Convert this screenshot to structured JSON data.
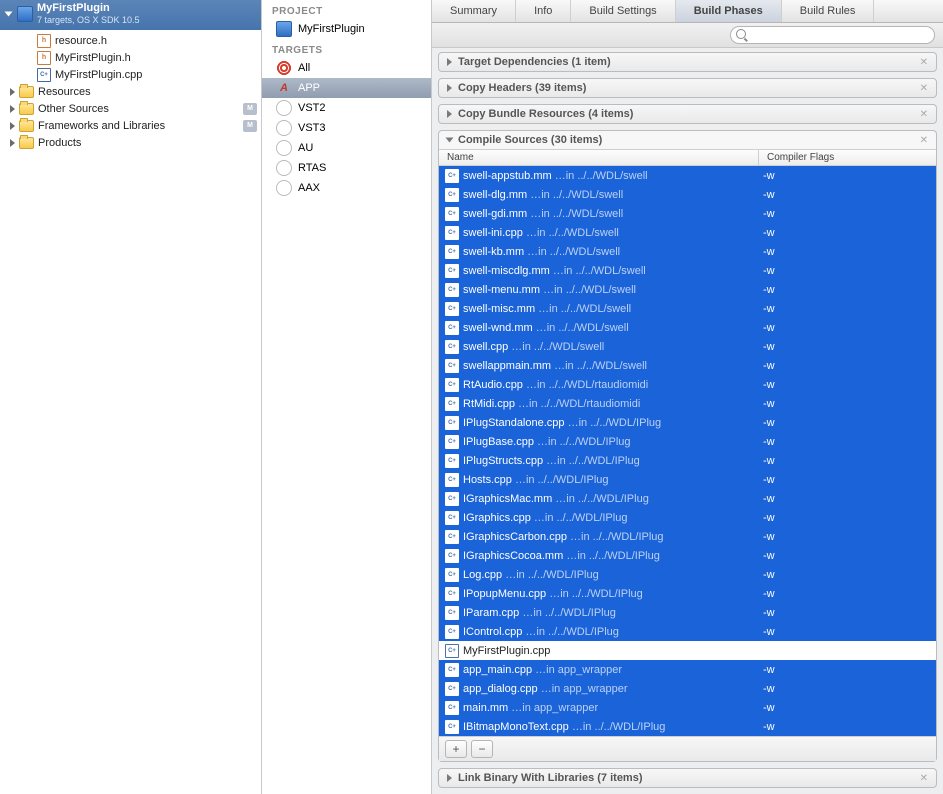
{
  "navigator": {
    "project": "MyFirstPlugin",
    "subtitle": "7 targets, OS X SDK 10.5",
    "files": [
      {
        "name": "resource.h",
        "icon": "h"
      },
      {
        "name": "MyFirstPlugin.h",
        "icon": "h"
      },
      {
        "name": "MyFirstPlugin.cpp",
        "icon": "cpp"
      }
    ],
    "groups": [
      {
        "name": "Resources",
        "badge": false
      },
      {
        "name": "Other Sources",
        "badge": true
      },
      {
        "name": "Frameworks and Libraries",
        "badge": true
      },
      {
        "name": "Products",
        "badge": false
      }
    ]
  },
  "sidebar": {
    "project_label": "PROJECT",
    "project_item": "MyFirstPlugin",
    "targets_label": "TARGETS",
    "targets": [
      {
        "name": "All",
        "icon": "bullseye",
        "selected": false
      },
      {
        "name": "APP",
        "icon": "aicon",
        "selected": true
      },
      {
        "name": "VST2",
        "icon": "circ",
        "selected": false
      },
      {
        "name": "VST3",
        "icon": "circ",
        "selected": false
      },
      {
        "name": "AU",
        "icon": "circ",
        "selected": false
      },
      {
        "name": "RTAS",
        "icon": "circ",
        "selected": false
      },
      {
        "name": "AAX",
        "icon": "circ",
        "selected": false
      }
    ]
  },
  "tabs": {
    "items": [
      "Summary",
      "Info",
      "Build Settings",
      "Build Phases",
      "Build Rules"
    ],
    "active": 3
  },
  "search": {
    "placeholder": ""
  },
  "phases": [
    {
      "title": "Target Dependencies (1 item)",
      "open": false
    },
    {
      "title": "Copy Headers (39 items)",
      "open": false
    },
    {
      "title": "Copy Bundle Resources (4 items)",
      "open": false
    },
    {
      "title": "Compile Sources (30 items)",
      "open": true
    },
    {
      "title": "Link Binary With Libraries (7 items)",
      "open": false
    }
  ],
  "compile": {
    "col_name": "Name",
    "col_flags": "Compiler Flags",
    "rows": [
      {
        "name": "swell-appstub.mm",
        "path": "…in ../../WDL/swell",
        "flag": "-w",
        "sel": true
      },
      {
        "name": "swell-dlg.mm",
        "path": "…in ../../WDL/swell",
        "flag": "-w",
        "sel": true
      },
      {
        "name": "swell-gdi.mm",
        "path": "…in ../../WDL/swell",
        "flag": "-w",
        "sel": true
      },
      {
        "name": "swell-ini.cpp",
        "path": "…in ../../WDL/swell",
        "flag": "-w",
        "sel": true
      },
      {
        "name": "swell-kb.mm",
        "path": "…in ../../WDL/swell",
        "flag": "-w",
        "sel": true
      },
      {
        "name": "swell-miscdlg.mm",
        "path": "…in ../../WDL/swell",
        "flag": "-w",
        "sel": true
      },
      {
        "name": "swell-menu.mm",
        "path": "…in ../../WDL/swell",
        "flag": "-w",
        "sel": true
      },
      {
        "name": "swell-misc.mm",
        "path": "…in ../../WDL/swell",
        "flag": "-w",
        "sel": true
      },
      {
        "name": "swell-wnd.mm",
        "path": "…in ../../WDL/swell",
        "flag": "-w",
        "sel": true
      },
      {
        "name": "swell.cpp",
        "path": "…in ../../WDL/swell",
        "flag": "-w",
        "sel": true
      },
      {
        "name": "swellappmain.mm",
        "path": "…in ../../WDL/swell",
        "flag": "-w",
        "sel": true
      },
      {
        "name": "RtAudio.cpp",
        "path": "…in ../../WDL/rtaudiomidi",
        "flag": "-w",
        "sel": true
      },
      {
        "name": "RtMidi.cpp",
        "path": "…in ../../WDL/rtaudiomidi",
        "flag": "-w",
        "sel": true
      },
      {
        "name": "IPlugStandalone.cpp",
        "path": "…in ../../WDL/IPlug",
        "flag": "-w",
        "sel": true
      },
      {
        "name": "IPlugBase.cpp",
        "path": "…in ../../WDL/IPlug",
        "flag": "-w",
        "sel": true
      },
      {
        "name": "IPlugStructs.cpp",
        "path": "…in ../../WDL/IPlug",
        "flag": "-w",
        "sel": true
      },
      {
        "name": "Hosts.cpp",
        "path": "…in ../../WDL/IPlug",
        "flag": "-w",
        "sel": true
      },
      {
        "name": "IGraphicsMac.mm",
        "path": "…in ../../WDL/IPlug",
        "flag": "-w",
        "sel": true
      },
      {
        "name": "IGraphics.cpp",
        "path": "…in ../../WDL/IPlug",
        "flag": "-w",
        "sel": true
      },
      {
        "name": "IGraphicsCarbon.cpp",
        "path": "…in ../../WDL/IPlug",
        "flag": "-w",
        "sel": true
      },
      {
        "name": "IGraphicsCocoa.mm",
        "path": "…in ../../WDL/IPlug",
        "flag": "-w",
        "sel": true
      },
      {
        "name": "Log.cpp",
        "path": "…in ../../WDL/IPlug",
        "flag": "-w",
        "sel": true
      },
      {
        "name": "IPopupMenu.cpp",
        "path": "…in ../../WDL/IPlug",
        "flag": "-w",
        "sel": true
      },
      {
        "name": "IParam.cpp",
        "path": "…in ../../WDL/IPlug",
        "flag": "-w",
        "sel": true
      },
      {
        "name": "IControl.cpp",
        "path": "…in ../../WDL/IPlug",
        "flag": "-w",
        "sel": true
      },
      {
        "name": "MyFirstPlugin.cpp",
        "path": "",
        "flag": "",
        "sel": false
      },
      {
        "name": "app_main.cpp",
        "path": "…in app_wrapper",
        "flag": "-w",
        "sel": true
      },
      {
        "name": "app_dialog.cpp",
        "path": "…in app_wrapper",
        "flag": "-w",
        "sel": true
      },
      {
        "name": "main.mm",
        "path": "…in app_wrapper",
        "flag": "-w",
        "sel": true
      },
      {
        "name": "IBitmapMonoText.cpp",
        "path": "…in ../../WDL/IPlug",
        "flag": "-w",
        "sel": true
      }
    ],
    "add": "+",
    "remove": "−"
  }
}
